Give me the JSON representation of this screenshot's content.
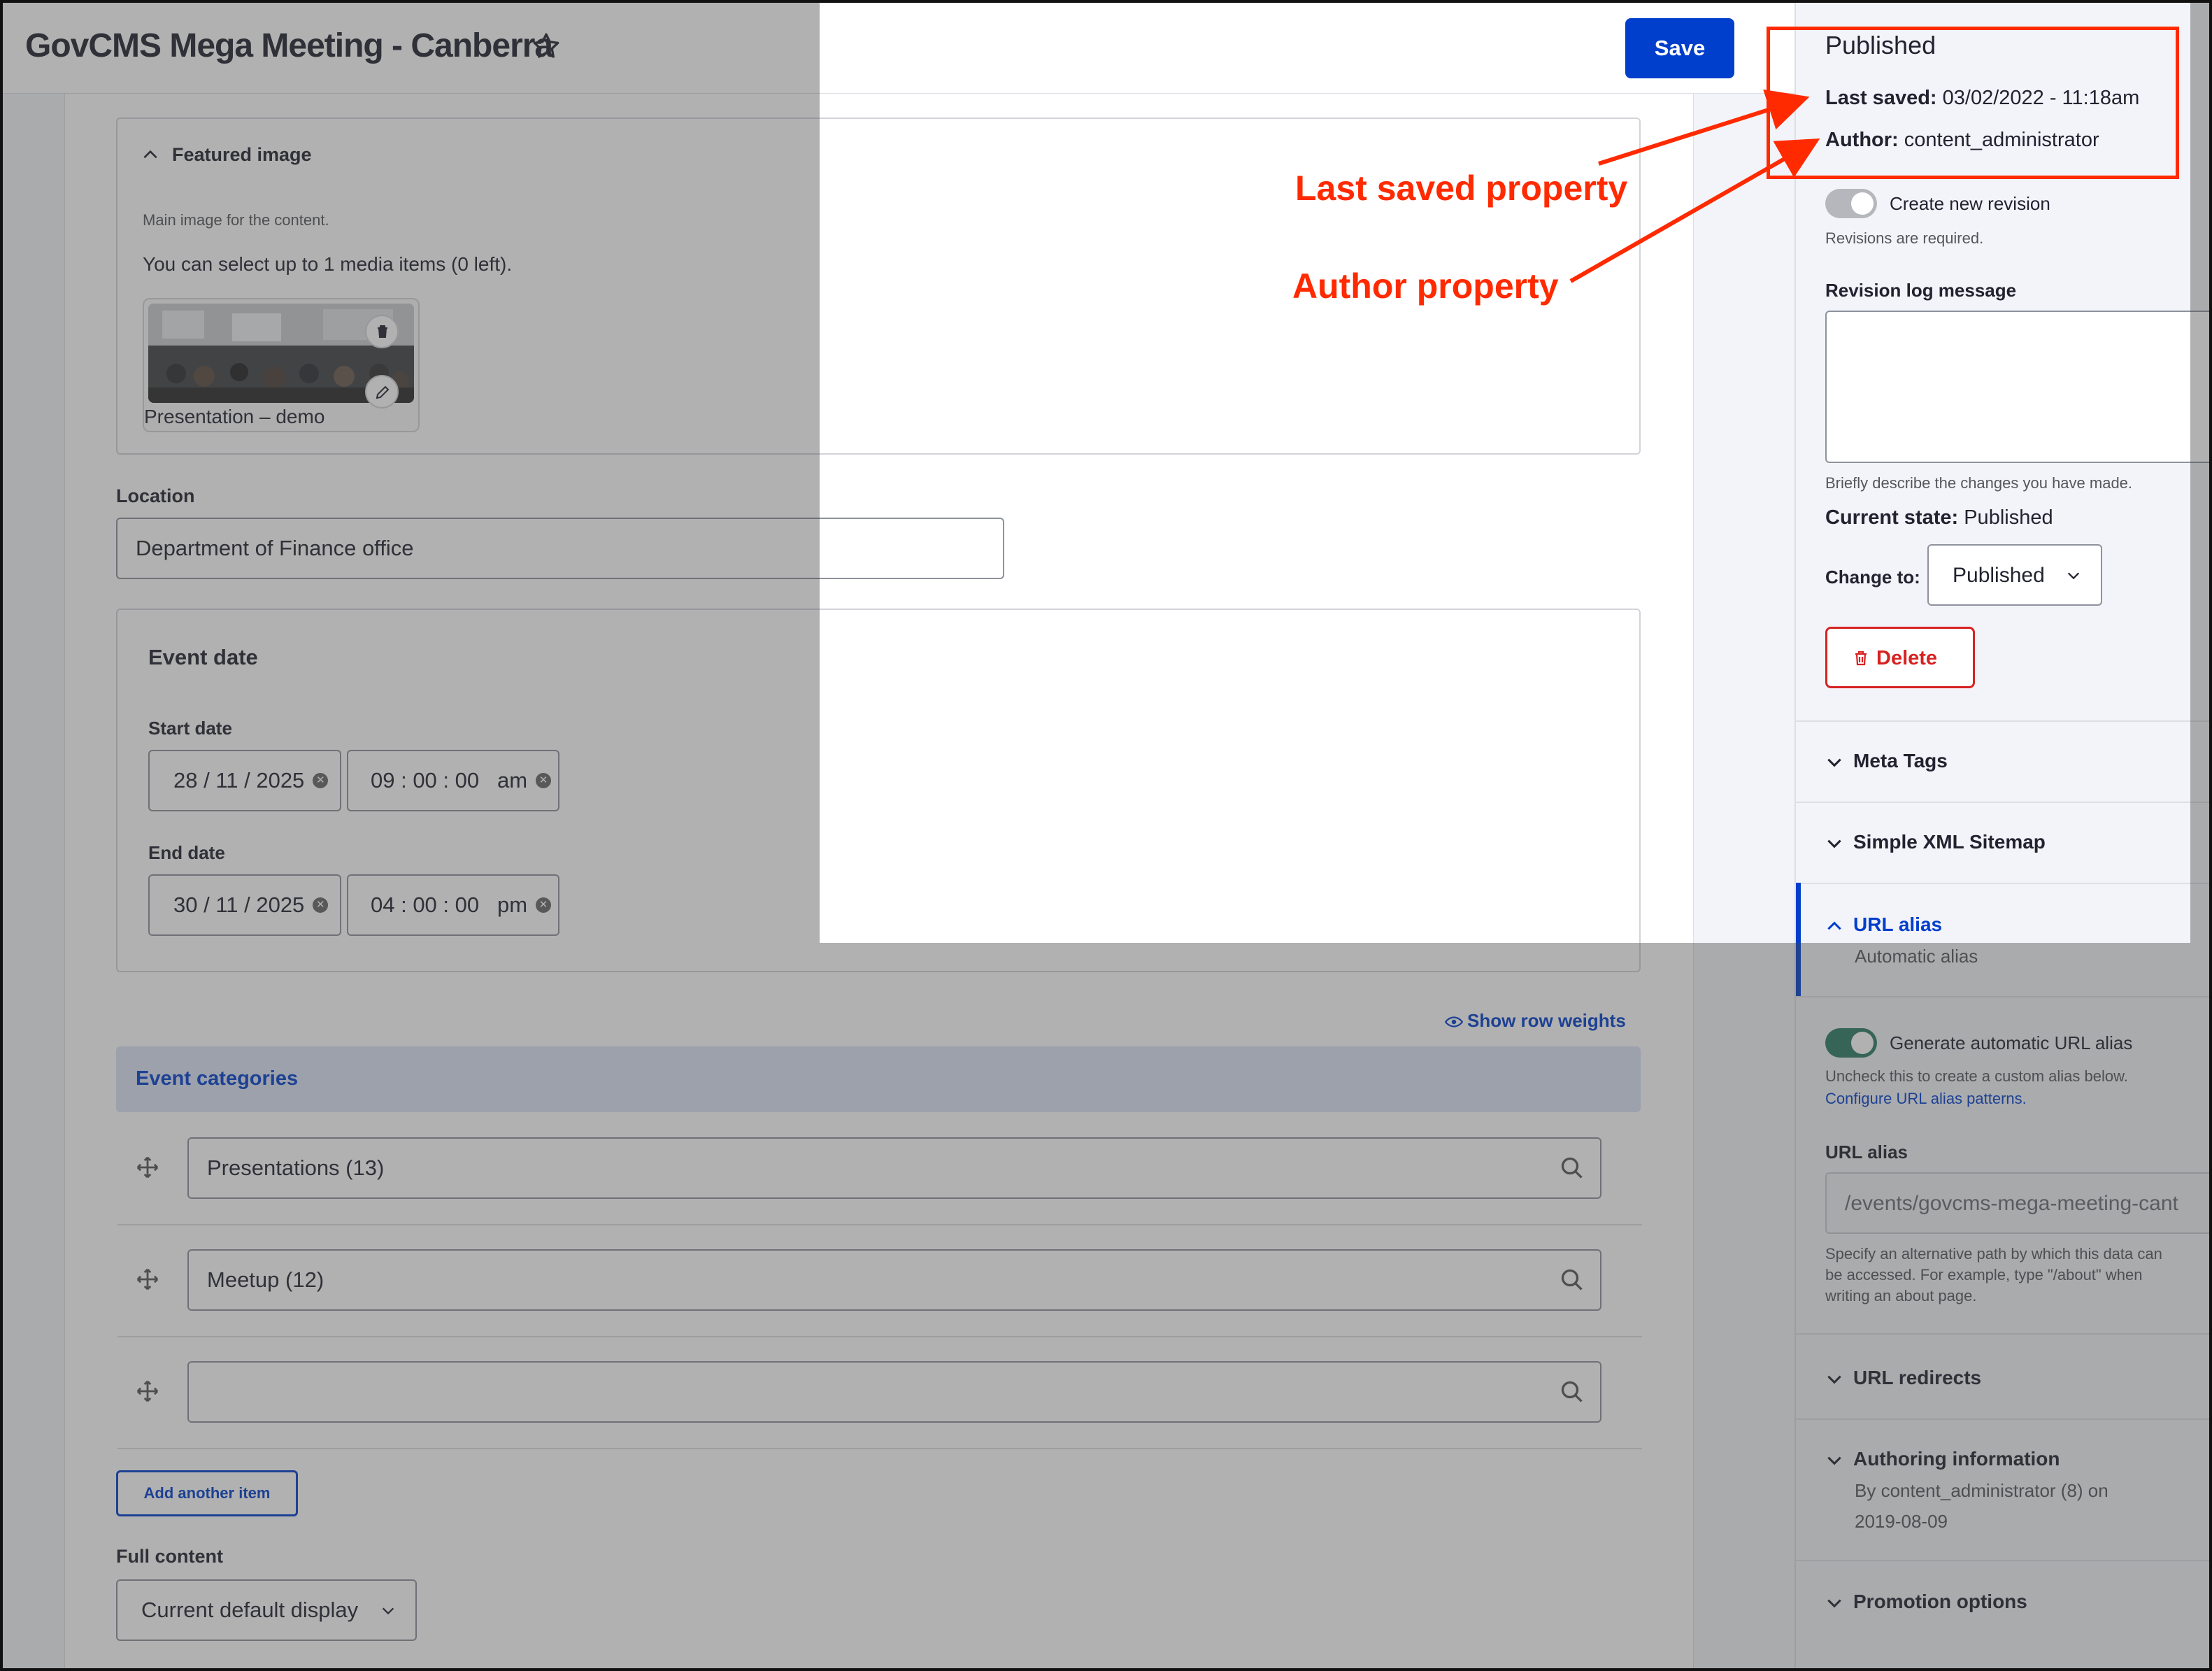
{
  "page": {
    "title": "GovCMS Mega Meeting - Canberra",
    "save_label": "Save"
  },
  "featured_image": {
    "heading": "Featured image",
    "description": "Main image for the content.",
    "limit_text": "You can select up to 1 media items (0 left).",
    "media_caption": "Presentation – demo"
  },
  "location": {
    "label": "Location",
    "value": "Department of Finance office"
  },
  "event_date": {
    "heading": "Event date",
    "start_label": "Start date",
    "start_date": "28 / 11 / 2025",
    "start_time": "09 : 00 : 00   am",
    "end_label": "End date",
    "end_date": "30 / 11 / 2025",
    "end_time": "04 : 00 : 00   pm"
  },
  "categories": {
    "show_weights": "Show row weights",
    "heading": "Event categories",
    "items": [
      "Presentations (13)",
      "Meetup (12)",
      ""
    ],
    "add_label": "Add another item"
  },
  "full_content": {
    "label": "Full content",
    "selected": "Current default display"
  },
  "sidebar": {
    "status": "Published",
    "last_saved_label": "Last saved:",
    "last_saved_value": "03/02/2022 - 11:18am",
    "author_label": "Author:",
    "author_value": "content_administrator",
    "create_revision": "Create new revision",
    "revisions_required": "Revisions are required.",
    "revision_log_label": "Revision log message",
    "revision_log_help": "Briefly describe the changes you have made.",
    "current_state_label": "Current state:",
    "current_state_value": "Published",
    "change_to_label": "Change to:",
    "change_to_value": "Published",
    "delete_label": "Delete",
    "meta_tags": "Meta Tags",
    "sitemap": "Simple XML Sitemap",
    "url_alias_heading": "URL alias",
    "url_alias_summary": "Automatic alias",
    "generate_alias": "Generate automatic URL alias",
    "generate_help": "Uncheck this to create a custom alias below.",
    "configure_link": "Configure URL alias patterns.",
    "url_alias_field_label": "URL alias",
    "url_alias_value": "/events/govcms-mega-meeting-cant",
    "url_alias_help_1": "Specify an alternative path by which this data can",
    "url_alias_help_2": "be accessed. For example, type \"/about\" when",
    "url_alias_help_3": "writing an about page.",
    "url_redirects": "URL redirects",
    "authoring_info": "Authoring information",
    "authoring_line_1": "By content_administrator (8) on",
    "authoring_line_2": "2019-08-09",
    "promotion": "Promotion options"
  },
  "annotations": {
    "last_saved": "Last saved property",
    "author": "Author property"
  },
  "colors": {
    "accent_blue": "#003ecc",
    "annotation_red": "#ff2a00",
    "delete_red": "#d72222",
    "toggle_green": "#2b7a62"
  }
}
